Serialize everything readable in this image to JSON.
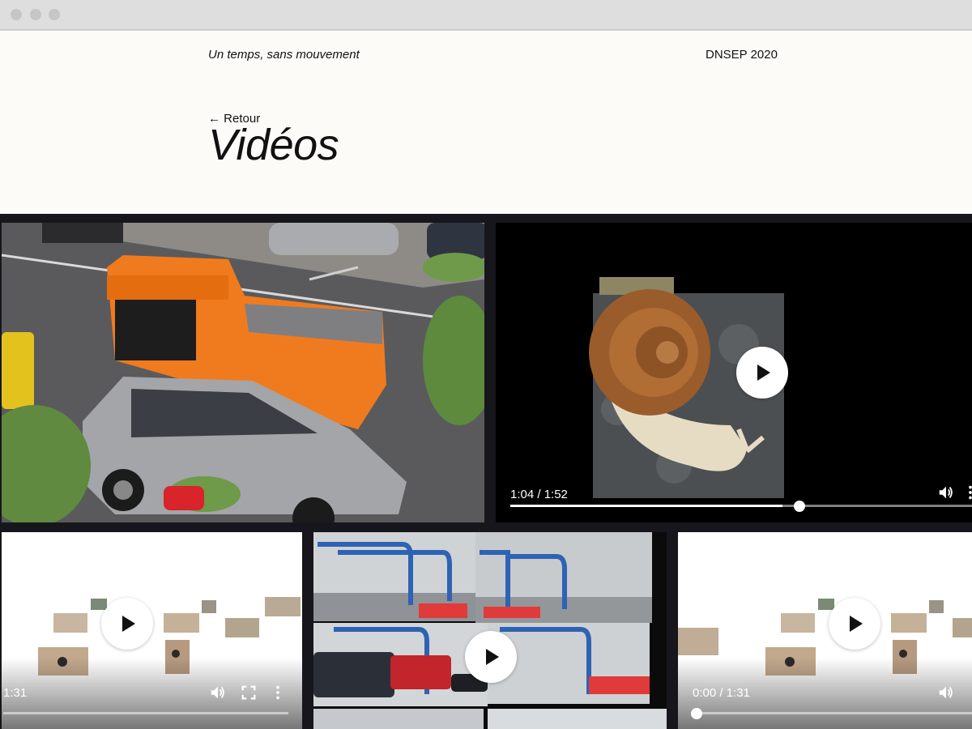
{
  "header": {
    "site_title": "Un temps, sans mouvement",
    "year": "DNSEP 2020",
    "back_label": "← Retour",
    "page_title": "Vidéos"
  },
  "videos": {
    "snail": {
      "time": "1:04 / 1:52",
      "progress": 0.58
    },
    "collage_left": {
      "time": "1:31"
    },
    "collage_right": {
      "time": "0:00 / 1:31",
      "progress": 0.0
    }
  },
  "icons": [
    "play-icon",
    "volume-icon",
    "fullscreen-icon",
    "more-options-icon"
  ],
  "colors": {
    "page_bg": "#fcfbf8",
    "gallery_bg": "#17161c"
  }
}
